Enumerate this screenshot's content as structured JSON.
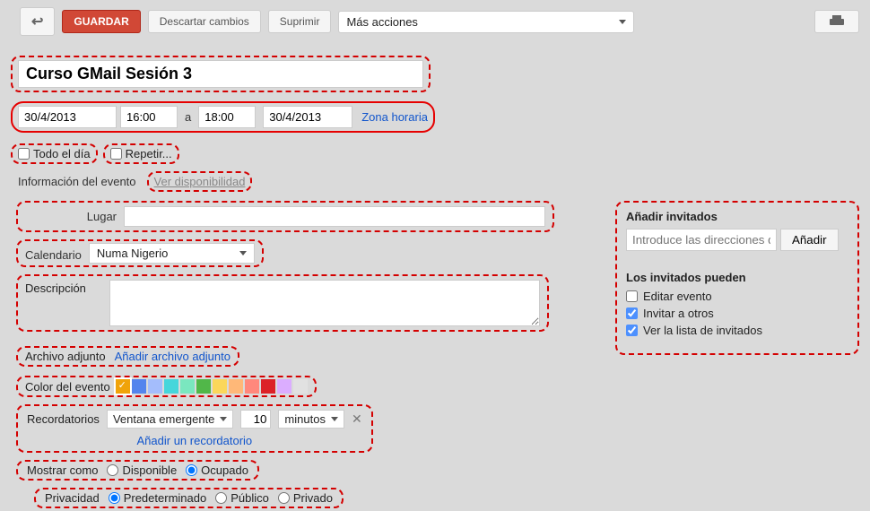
{
  "toolbar": {
    "save": "GUARDAR",
    "discard": "Descartar cambios",
    "delete": "Suprimir",
    "more": "Más acciones"
  },
  "event": {
    "title": "Curso GMail Sesión 3",
    "date_start": "30/4/2013",
    "time_start": "16:00",
    "to": "a",
    "time_end": "18:00",
    "date_end": "30/4/2013",
    "timezone": "Zona horaria",
    "all_day": "Todo el día",
    "repeat": "Repetir..."
  },
  "tabs": {
    "info": "Información del evento",
    "avail": "Ver disponibilidad"
  },
  "form": {
    "place_lbl": "Lugar",
    "calendar_lbl": "Calendario",
    "calendar_val": "Numa Nigerio",
    "desc_lbl": "Descripción",
    "attach_lbl": "Archivo adjunto",
    "attach_link": "Añadir archivo adjunto",
    "color_lbl": "Color del evento",
    "reminders_lbl": "Recordatorios",
    "reminder_type": "Ventana emergente",
    "reminder_num": "10",
    "reminder_unit": "minutos",
    "reminder_add": "Añadir un recordatorio",
    "show_as_lbl": "Mostrar como",
    "show_available": "Disponible",
    "show_busy": "Ocupado",
    "privacy_lbl": "Privacidad",
    "priv_default": "Predeterminado",
    "priv_public": "Público",
    "priv_private": "Privado"
  },
  "colors": [
    "#f0a30a",
    "#5484ed",
    "#a4bdfc",
    "#46d6db",
    "#7ae7bf",
    "#51b749",
    "#fbd75b",
    "#ffb878",
    "#ff887c",
    "#dc2127",
    "#dbadff",
    "#e1e1e1"
  ],
  "guests": {
    "title": "Añadir invitados",
    "placeholder": "Introduce las direcciones de",
    "add": "Añadir",
    "can_title": "Los invitados pueden",
    "edit": "Editar evento",
    "invite": "Invitar a otros",
    "see": "Ver la lista de invitados"
  }
}
